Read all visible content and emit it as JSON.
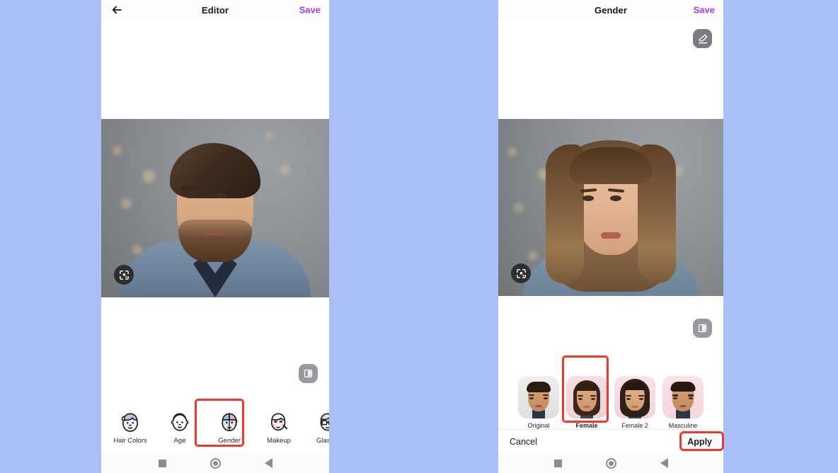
{
  "background_color": "#a9bff5",
  "accent_color": "#a63df6",
  "annotation_color": "#f3392f",
  "left_phone": {
    "appbar": {
      "back_icon": "back-arrow-icon",
      "title": "Editor",
      "save_label": "Save"
    },
    "photo": {
      "alt": "Portrait photo of a man with brown hair, beard and denim shirt on a gray bokeh background",
      "lens_icon": "google-lens-icon"
    },
    "compare_icon": "compare-split-icon",
    "features": [
      {
        "label": "Hair Colors",
        "icon": "hair-colors-face-icon",
        "selected": false
      },
      {
        "label": "Age",
        "icon": "age-face-icon",
        "selected": false
      },
      {
        "label": "Gender",
        "icon": "gender-split-face-icon",
        "selected": true
      },
      {
        "label": "Makeup",
        "icon": "makeup-face-icon",
        "selected": false
      },
      {
        "label": "Glasses",
        "icon": "glasses-face-icon",
        "selected": false
      }
    ],
    "navbar": {
      "recents_icon": "square-recents-icon",
      "home_icon": "circle-home-icon",
      "back_icon": "triangle-back-icon"
    }
  },
  "right_phone": {
    "appbar": {
      "title": "Gender",
      "save_label": "Save"
    },
    "eraser_icon": "eraser-icon",
    "photo": {
      "alt": "Gender-swapped result: woman with long brown hair on a gray bokeh background",
      "lens_icon": "google-lens-icon"
    },
    "compare_icon": "compare-split-icon",
    "thumbnails": [
      {
        "label": "Original",
        "selected": false
      },
      {
        "label": "Female",
        "selected": true
      },
      {
        "label": "Female 2",
        "selected": false
      },
      {
        "label": "Masculine",
        "selected": false
      }
    ],
    "actions": {
      "cancel_label": "Cancel",
      "apply_label": "Apply"
    },
    "navbar": {
      "recents_icon": "square-recents-icon",
      "home_icon": "circle-home-icon",
      "back_icon": "triangle-back-icon"
    }
  },
  "annotations": [
    {
      "target": "gender-feature",
      "color": "#f3392f"
    },
    {
      "target": "female-thumbnail",
      "color": "#f3392f"
    },
    {
      "target": "apply-button",
      "color": "#f3392f"
    }
  ]
}
